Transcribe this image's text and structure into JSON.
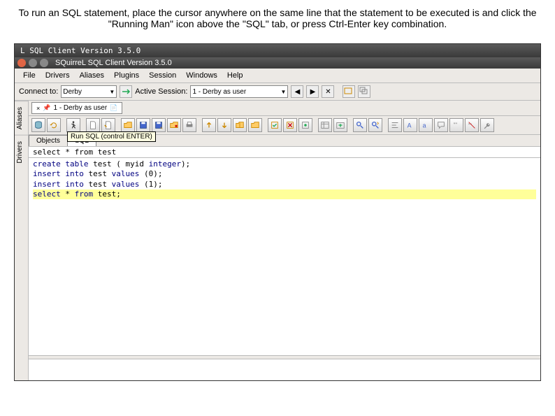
{
  "instruction": "To run an SQL statement, place the cursor anywhere on the same line that the statement to be executed is and click the \"Running Man\" icon above the \"SQL\" tab, or press Ctrl-Enter key combination.",
  "outer_title": "L SQL Client Version 3.5.0",
  "window_title": "SQuirreL SQL Client Version 3.5.0",
  "menu": [
    "File",
    "Drivers",
    "Aliases",
    "Plugins",
    "Session",
    "Windows",
    "Help"
  ],
  "toolbar": {
    "connect_label": "Connect to:",
    "connect_value": "Derby",
    "session_label": "Active Session:",
    "session_value": "1 - Derby  as user"
  },
  "side_tabs": [
    "Aliases",
    "Drivers"
  ],
  "doc_tab": {
    "label": "1 - Derby  as user"
  },
  "sub_tabs": [
    "Objects",
    "SQL"
  ],
  "tooltip": "Run SQL (control ENTER)",
  "query_line": "select * from test",
  "code_lines": [
    {
      "text": "create table test ( myid integer);",
      "highlight": false
    },
    {
      "text": "insert into test values (0);",
      "highlight": false
    },
    {
      "text": "insert into test values (1);",
      "highlight": false
    },
    {
      "text": "select * from test;",
      "highlight": true
    }
  ]
}
